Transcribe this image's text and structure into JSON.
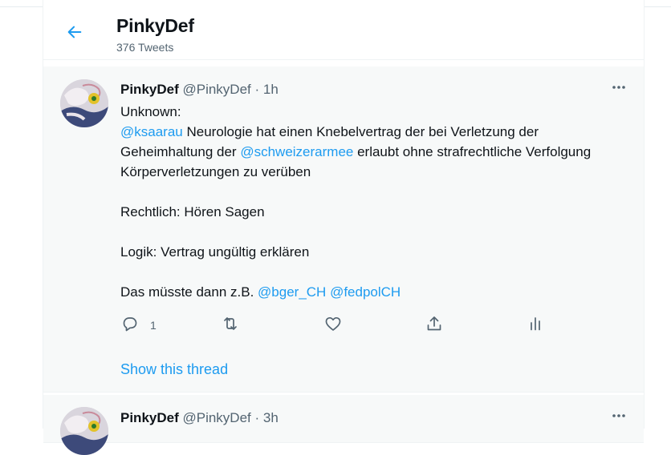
{
  "header": {
    "title": "PinkyDef",
    "subtitle": "376 Tweets"
  },
  "tweets": [
    {
      "name": "PinkyDef",
      "handle": "@PinkyDef",
      "separator": "·",
      "time": "1h",
      "body": {
        "line1": "Unknown:",
        "mention1": "@ksaarau",
        "text1": " Neurologie hat einen Knebelvertrag der bei Verletzung der Geheimhaltung der ",
        "mention2": "@schweizerarmee",
        "text2": " erlaubt ohne strafrechtliche Verfolgung Körperverletzungen zu verüben",
        "para2": "Rechtlich: Hören Sagen",
        "para3": "Logik: Vertrag ungültig erklären",
        "para4_text": "Das müsste dann z.B. ",
        "para4_mention1": "@bger_CH",
        "para4_space": " ",
        "para4_mention2": "@fedpolCH"
      },
      "reply_count": "1",
      "show_thread": "Show this thread"
    },
    {
      "name": "PinkyDef",
      "handle": "@PinkyDef",
      "separator": "·",
      "time": "3h"
    }
  ],
  "icons": {
    "back": "arrow-left-icon",
    "more": "more-horizontal-icon",
    "reply": "reply-icon",
    "retweet": "retweet-icon",
    "like": "heart-icon",
    "share": "share-icon",
    "analytics": "analytics-icon"
  },
  "colors": {
    "accent": "#1d9bf0",
    "text": "#0f1419",
    "muted": "#536471",
    "tweet_bg": "#f7f9f9"
  }
}
